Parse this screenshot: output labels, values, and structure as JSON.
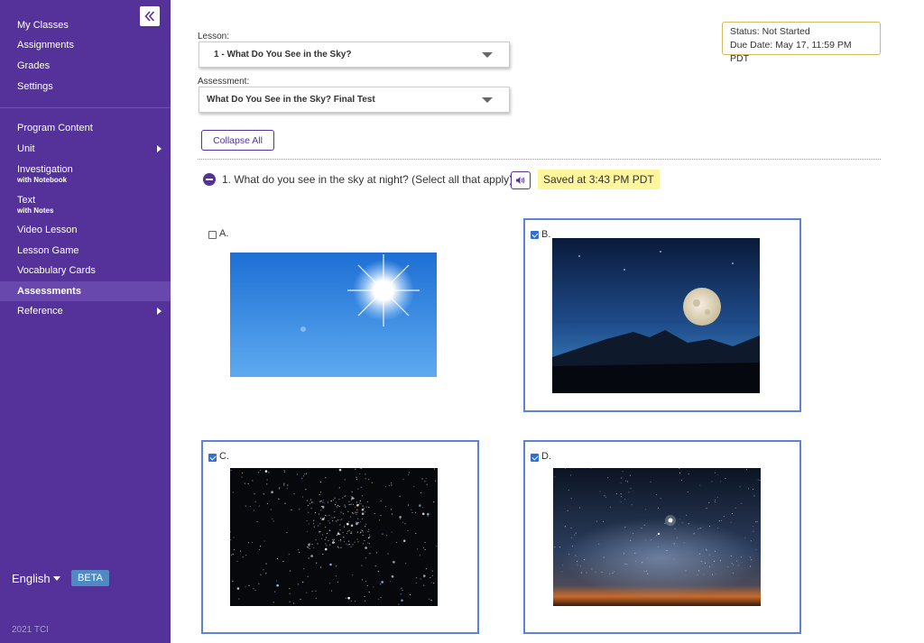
{
  "sidebar": {
    "top_items": [
      {
        "label": "My Classes"
      },
      {
        "label": "Assignments"
      },
      {
        "label": "Grades"
      },
      {
        "label": "Settings"
      }
    ],
    "content_items": [
      {
        "label": "Program Content",
        "sub": ""
      },
      {
        "label": "Unit",
        "sub": ""
      },
      {
        "label": "Investigation",
        "sub": "with Notebook"
      },
      {
        "label": "Text",
        "sub": "with Notes"
      },
      {
        "label": "Video Lesson",
        "sub": ""
      },
      {
        "label": "Lesson Game",
        "sub": ""
      },
      {
        "label": "Vocabulary Cards",
        "sub": ""
      },
      {
        "label": "Assessments",
        "sub": ""
      },
      {
        "label": "Reference",
        "sub": ""
      }
    ],
    "language": "English",
    "beta": "BETA",
    "copyright": "2021 TCI"
  },
  "lesson": {
    "label": "Lesson:",
    "value": "1 - What Do You See in the Sky?"
  },
  "assessment": {
    "label": "Assessment:",
    "value": "What Do You See in the Sky? Final Test"
  },
  "status": {
    "status_line": "Status: Not Started",
    "due_line": "Due Date: May 17, 11:59 PM PDT"
  },
  "collapse_all": "Collapse All",
  "question": {
    "text": "1. What do you see in the sky at night?  (Select all that apply)",
    "saved": "Saved at 3:43 PM PDT"
  },
  "options": [
    {
      "letter": "A.",
      "checked": false,
      "image": "sun-in-blue-sky"
    },
    {
      "letter": "B.",
      "checked": true,
      "image": "full-moon-over-mountains"
    },
    {
      "letter": "C.",
      "checked": true,
      "image": "star-cluster"
    },
    {
      "letter": "D.",
      "checked": true,
      "image": "bright-star-over-horizon"
    }
  ],
  "colors": {
    "sidebar": "#54329a",
    "accent": "#5b84d9",
    "saved_highlight": "#fff59d",
    "status_border": "#d6b85f"
  }
}
